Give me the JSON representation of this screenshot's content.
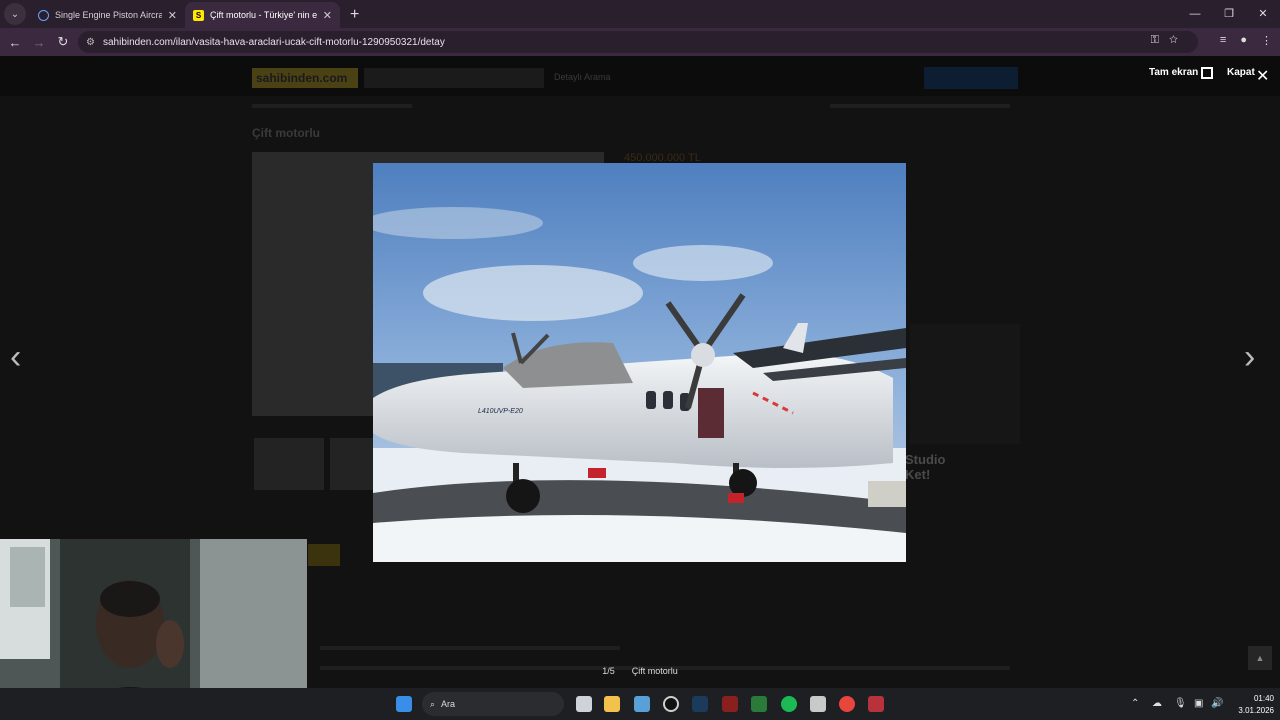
{
  "browser": {
    "tabs": [
      {
        "title": "Single Engine Piston Aircraft Fo",
        "active": false
      },
      {
        "title": "Çift motorlu - Türkiye' nin en b",
        "active": true
      }
    ],
    "url": "sahibinden.com/ilan/vasita-hava-araclari-ucak-cift-motorlu-1290950321/detay"
  },
  "lightbox": {
    "fullscreen_label": "Tam ekran",
    "close_label": "Kapat",
    "counter": "1/5",
    "caption": "Çift motorlu",
    "aircraft_registration": "L410UVP-E20"
  },
  "background_page": {
    "logo": "sahibinden.com",
    "search_detail": "Detaylı Arama",
    "listing_title": "Çift motorlu",
    "price": "450.000.000 TL",
    "sidebar_ad": "Studio\nKet!"
  },
  "taskbar": {
    "search_placeholder": "Ara",
    "time": "01:40",
    "date": "3.01.2026"
  },
  "colors": {
    "tab_strip": "#2a1f2d",
    "toolbar": "#3b2a3f",
    "accent_logo": "#ffe800",
    "overlay_dim": "#121212"
  }
}
